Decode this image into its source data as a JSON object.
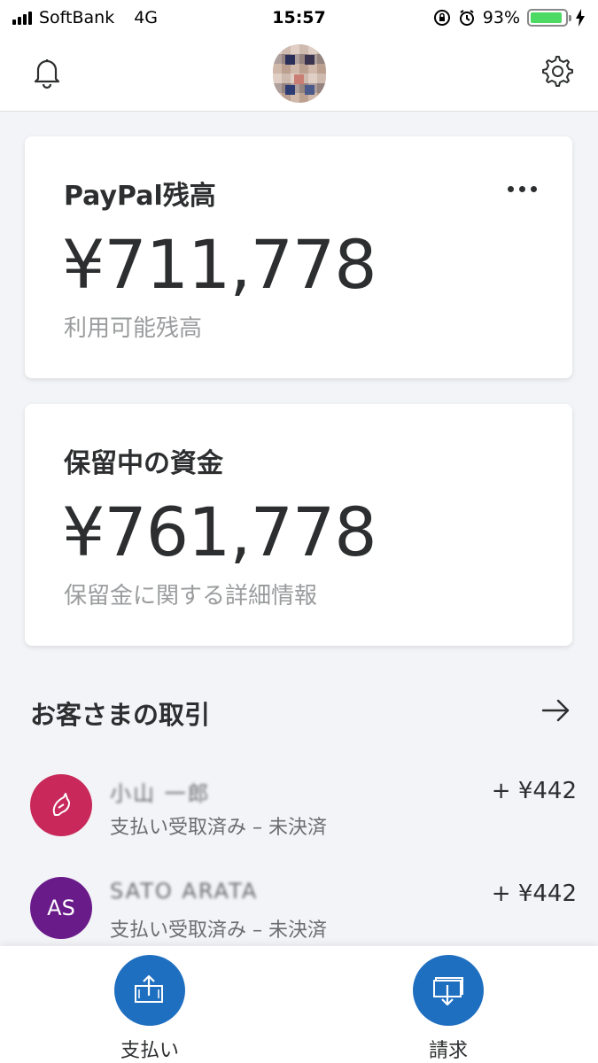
{
  "status_bar": {
    "carrier": "SoftBank",
    "network": "4G",
    "time": "15:57",
    "battery_percent": "93%",
    "battery_level": 0.93,
    "battery_color": "#4cd964"
  },
  "header": {
    "icons": [
      "bell-icon",
      "profile-avatar",
      "gear-icon"
    ]
  },
  "balance_card": {
    "title": "PayPal残高",
    "amount": "¥711,778",
    "subtitle": "利用可能残高",
    "menu_icon": "more-dots-icon"
  },
  "hold_card": {
    "title": "保留中の資金",
    "amount": "¥761,778",
    "subtitle": "保留金に関する詳細情報"
  },
  "transactions": {
    "title": "お客さまの取引",
    "items": [
      {
        "initials": "",
        "avatar_color": "#c8295a",
        "name": "小山 一郎",
        "status": "支払い受取済み – 未決済",
        "amount": "+ ¥442"
      },
      {
        "initials": "AS",
        "avatar_color": "#6a1b8a",
        "name": "SATO ARATA",
        "status": "支払い受取済み – 未決済",
        "amount": "+ ¥442"
      }
    ]
  },
  "bottom_actions": {
    "pay_label": "支払い",
    "request_label": "請求",
    "accent_color": "#1f6fc0"
  }
}
